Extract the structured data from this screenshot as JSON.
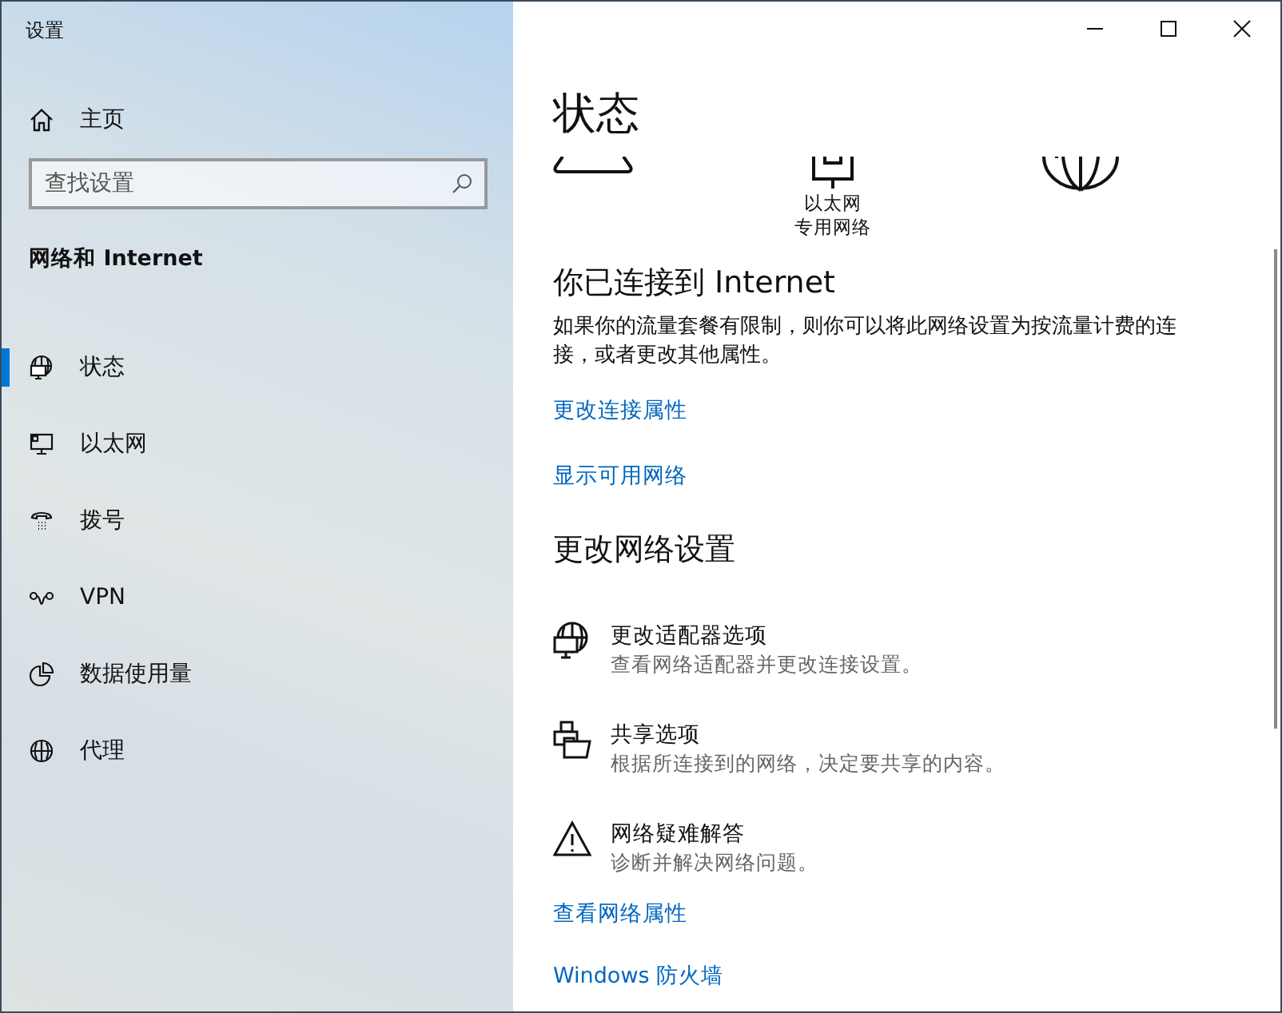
{
  "window": {
    "title": "设置"
  },
  "sidebar": {
    "home": "主页",
    "search": {
      "placeholder": "查找设置"
    },
    "section": "网络和 Internet",
    "items": [
      {
        "kind": "status",
        "label": "状态",
        "selected": true
      },
      {
        "kind": "ethernet",
        "label": "以太网",
        "selected": false
      },
      {
        "kind": "dialup",
        "label": "拨号",
        "selected": false
      },
      {
        "kind": "vpn",
        "label": "VPN",
        "selected": false
      },
      {
        "kind": "data",
        "label": "数据使用量",
        "selected": false
      },
      {
        "kind": "proxy",
        "label": "代理",
        "selected": false
      }
    ]
  },
  "main": {
    "title": "状态",
    "diagram_labels": [
      "以太网",
      "专用网络"
    ],
    "connected": {
      "heading": "你已连接到 Internet",
      "description": "如果你的流量套餐有限制，则你可以将此网络设置为按流量计费的连接，或者更改其他属性。"
    },
    "links": [
      "更改连接属性",
      "显示可用网络"
    ],
    "section": "更改网络设置",
    "options": [
      {
        "kind": "adapter",
        "title": "更改适配器选项",
        "description": "查看网络适配器并更改连接设置。"
      },
      {
        "kind": "sharing",
        "title": "共享选项",
        "description": "根据所连接到的网络，决定要共享的内容。"
      },
      {
        "kind": "troubleshoot",
        "title": "网络疑难解答",
        "description": "诊断并解决网络问题。"
      }
    ],
    "bottom_links": [
      "查看网络属性",
      "Windows 防火墙"
    ]
  }
}
